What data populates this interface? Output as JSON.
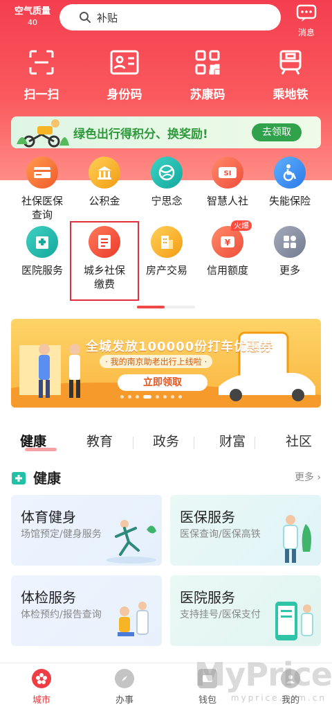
{
  "header": {
    "air_quality_label": "空气质量",
    "air_quality_value": "40",
    "search_placeholder": "补贴",
    "message_label": "消息"
  },
  "quick_actions": [
    {
      "label": "扫一扫",
      "icon": "scan-icon"
    },
    {
      "label": "身份码",
      "icon": "id-card-icon"
    },
    {
      "label": "苏康码",
      "icon": "qr-code-icon"
    },
    {
      "label": "乘地铁",
      "icon": "metro-icon"
    }
  ],
  "green_banner": {
    "text": "绿色出行得积分、换奖励!",
    "button": "去领取"
  },
  "services": [
    {
      "label": "社保医保\n查询",
      "icon": "card-icon",
      "color": "#f7763b"
    },
    {
      "label": "公积金",
      "icon": "bank-icon",
      "color": "#f6a623"
    },
    {
      "label": "宁思念",
      "icon": "globe-icon",
      "color": "#1cc1b8"
    },
    {
      "label": "智慧人社",
      "icon": "si-icon",
      "color": "#f26b4a"
    },
    {
      "label": "失能保险",
      "icon": "wheelchair-icon",
      "color": "#3c8ef3"
    },
    {
      "label": "医院服务",
      "icon": "hospital-icon",
      "color": "#25b8a8"
    },
    {
      "label": "城乡社保\n缴费",
      "icon": "document-icon",
      "color": "#f15740"
    },
    {
      "label": "房产交易",
      "icon": "building-icon",
      "color": "#f6a623"
    },
    {
      "label": "信用额度",
      "icon": "yen-icon",
      "color": "#f5603f",
      "badge": "火爆"
    },
    {
      "label": "更多",
      "icon": "grid-icon",
      "color": "#8a93a6"
    }
  ],
  "promo_banner": {
    "title": "全城发放100000份打车优惠券",
    "subtitle": "· 我的南京助老出行上线啦 ·",
    "button": "立即领取"
  },
  "tabs": [
    "健康",
    "教育",
    "政务",
    "财富",
    "社区"
  ],
  "section": {
    "title": "健康",
    "more": "更多"
  },
  "cards": [
    {
      "title": "体育健身",
      "subtitle": "场馆预定/健身服务"
    },
    {
      "title": "医保服务",
      "subtitle": "医保查询/医保高铁"
    },
    {
      "title": "体检服务",
      "subtitle": "体检预约/报告查询"
    },
    {
      "title": "医院服务",
      "subtitle": "支持挂号/医保支付"
    }
  ],
  "bottom_nav": [
    "城市",
    "办事",
    "钱包",
    "我的"
  ],
  "watermark": {
    "brand": "MyPrice",
    "url": "myprice.com.cn"
  },
  "colors": {
    "brand_red": "#f43e4f",
    "green": "#2fa24b"
  }
}
